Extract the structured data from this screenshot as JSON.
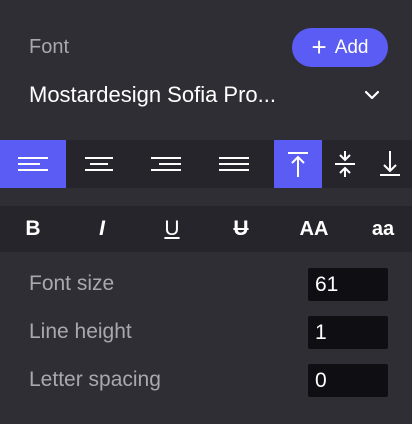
{
  "font_section": {
    "label": "Font",
    "add_button": "Add",
    "font_name": "Mostardesign Sofia Pro..."
  },
  "alignment": {
    "horizontal": [
      "align-left",
      "align-center",
      "align-right",
      "justify"
    ],
    "vertical": [
      "align-top",
      "align-middle",
      "align-bottom"
    ],
    "active_horizontal": "align-left",
    "active_vertical": "align-top"
  },
  "text_style": {
    "bold": "B",
    "italic": "I",
    "underline": "U",
    "strikethrough": "U",
    "uppercase": "AA",
    "lowercase": "aa"
  },
  "properties": {
    "font_size": {
      "label": "Font size",
      "value": "61"
    },
    "line_height": {
      "label": "Line height",
      "value": "1"
    },
    "letter_spacing": {
      "label": "Letter spacing",
      "value": "0"
    }
  },
  "colors": {
    "accent": "#5b5cf4",
    "panel_bg": "#2f2e34",
    "bar_bg": "#26252b",
    "input_bg": "#0f0e12"
  }
}
